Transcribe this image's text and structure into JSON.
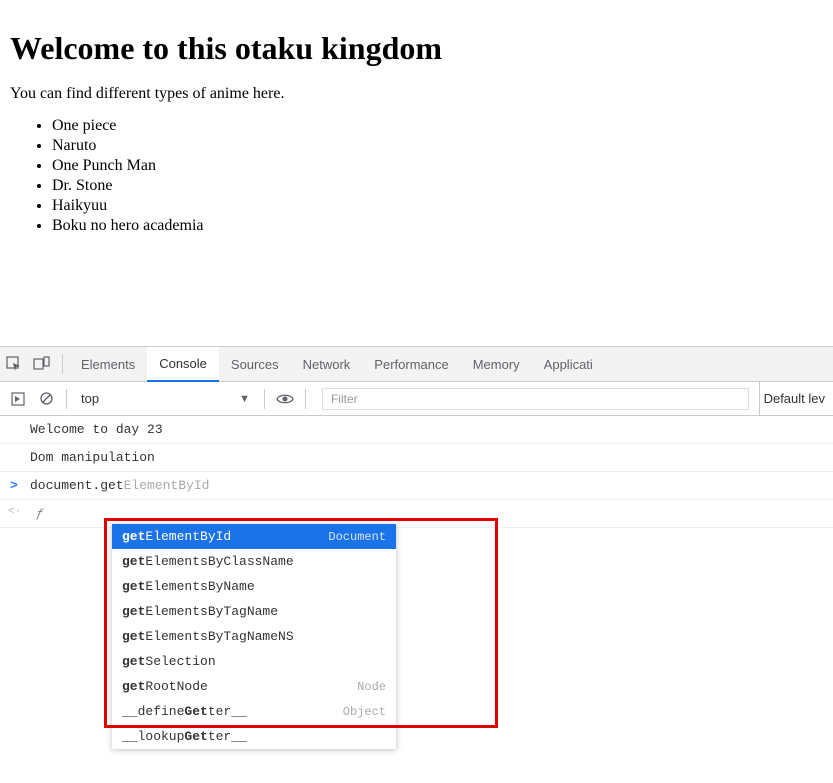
{
  "page": {
    "heading": "Welcome to this otaku kingdom",
    "subtext": "You can find different types of anime here.",
    "list": [
      "One piece",
      "Naruto",
      "One Punch Man",
      "Dr. Stone",
      "Haikyuu",
      "Boku no hero academia"
    ]
  },
  "devtools": {
    "tabs": {
      "elements": "Elements",
      "console": "Console",
      "sources": "Sources",
      "network": "Network",
      "performance": "Performance",
      "memory": "Memory",
      "application": "Applicati"
    },
    "toolbar": {
      "context": "top",
      "filter_placeholder": "Filter",
      "level": "Default lev"
    },
    "console": {
      "line1": "Welcome to day 23",
      "line2": "Dom manipulation",
      "prompt_typed": "document.get",
      "prompt_suggestion": "ElementById",
      "return_symbol": "ƒ"
    },
    "autocomplete": {
      "rows": [
        {
          "prefix": "get",
          "match": "ElementById",
          "meta": "Document",
          "selected": true
        },
        {
          "prefix": "get",
          "match": "ElementsByClassName",
          "meta": "",
          "selected": false
        },
        {
          "prefix": "get",
          "match": "ElementsByName",
          "meta": "",
          "selected": false
        },
        {
          "prefix": "get",
          "match": "ElementsByTagName",
          "meta": "",
          "selected": false
        },
        {
          "prefix": "get",
          "match": "ElementsByTagNameNS",
          "meta": "",
          "selected": false
        },
        {
          "prefix": "get",
          "match": "Selection",
          "meta": "",
          "selected": false
        },
        {
          "prefix": "get",
          "match": "RootNode",
          "meta": "Node",
          "selected": false
        },
        {
          "prefix_u": "__define",
          "bold": "Get",
          "suffix": "ter__",
          "meta": "Object",
          "selected": false
        },
        {
          "prefix_u": "__lookup",
          "bold": "Get",
          "suffix": "ter__",
          "meta": "",
          "selected": false
        }
      ]
    }
  }
}
